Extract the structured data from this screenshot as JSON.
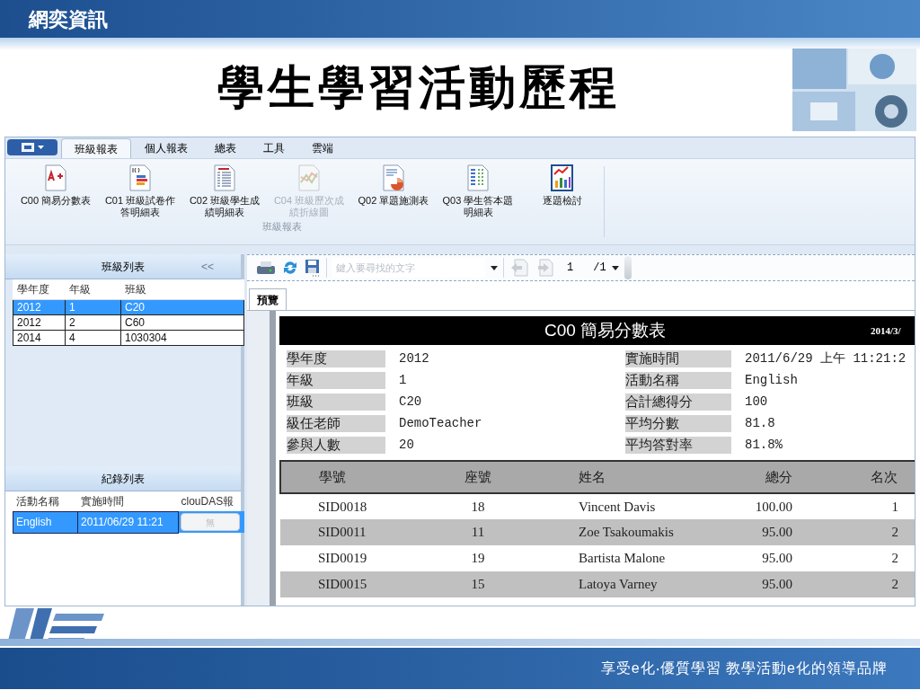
{
  "slide": {
    "brand": "網奕資訊",
    "title": "學生學習活動歷程",
    "slogan": "享受e化‧優質學習 教學活動e化的領導品牌"
  },
  "ribbon_tabs": [
    {
      "label": "班級報表",
      "selected": true
    },
    {
      "label": "個人報表",
      "selected": false
    },
    {
      "label": "總表",
      "selected": false
    },
    {
      "label": "工具",
      "selected": false
    },
    {
      "label": "雲端",
      "selected": false
    }
  ],
  "ribbon_buttons": [
    {
      "kind": "grade",
      "label": "C00 簡易分數表",
      "disabled": false
    },
    {
      "kind": "bars",
      "label": "C01 班級試卷作答明細表",
      "disabled": false
    },
    {
      "kind": "list",
      "label": "C02 班級學生成績明細表",
      "disabled": false
    },
    {
      "kind": "line",
      "label": "C04 班級歷次成績折線圖",
      "disabled": true
    },
    {
      "kind": "pie",
      "label": "Q02 單題施測表",
      "disabled": false
    },
    {
      "kind": "matrix",
      "label": "Q03 學生答本題明細表",
      "disabled": false
    },
    {
      "kind": "chart",
      "label": "逐題檢討",
      "disabled": false
    }
  ],
  "ribbon_group": "班級報表",
  "class_list": {
    "title": "班級列表",
    "collapse": "<<",
    "columns": [
      "學年度",
      "年級",
      "班級"
    ],
    "rows": [
      {
        "cells": [
          "2012",
          "1",
          "C20"
        ],
        "selected": true
      },
      {
        "cells": [
          "2012",
          "2",
          "C60"
        ],
        "selected": false
      },
      {
        "cells": [
          "2014",
          "4",
          "1030304"
        ],
        "selected": false
      }
    ]
  },
  "record_list": {
    "title": "紀錄列表",
    "columns": [
      "活動名稱",
      "實施時間",
      "clouDAS報"
    ],
    "rows": [
      {
        "cells": [
          "English",
          "2011/06/29 11:21"
        ],
        "button": "無",
        "selected": true
      }
    ]
  },
  "toolbar": {
    "search_placeholder": "鍵入要尋找的文字",
    "page": "1",
    "total": "/1"
  },
  "preview_tab": {
    "label": "預覽",
    "selected": true
  },
  "report": {
    "title": "C00 簡易分數表",
    "date": "2014/3/",
    "fields_left": [
      {
        "label": "學年度",
        "value": "2012"
      },
      {
        "label": "年級",
        "value": "1"
      },
      {
        "label": "班級",
        "value": "C20"
      },
      {
        "label": "級任老師",
        "value": "DemoTeacher"
      },
      {
        "label": "參與人數",
        "value": "20"
      }
    ],
    "fields_right": [
      {
        "label": "實施時間",
        "value": "2011/6/29 上午 11:21:2"
      },
      {
        "label": "活動名稱",
        "value": "English"
      },
      {
        "label": "合計總得分",
        "value": "100"
      },
      {
        "label": "平均分數",
        "value": "81.8"
      },
      {
        "label": "平均答對率",
        "value": "81.8%"
      }
    ],
    "columns": [
      "學號",
      "座號",
      "姓名",
      "總分",
      "名次"
    ],
    "rows": [
      [
        "SID0018",
        "18",
        "Vincent Davis",
        "100.00",
        "1"
      ],
      [
        "SID0011",
        "11",
        "Zoe Tsakoumakis",
        "95.00",
        "2"
      ],
      [
        "SID0019",
        "19",
        "Bartista Malone",
        "95.00",
        "2"
      ],
      [
        "SID0015",
        "15",
        "Latoya Varney",
        "95.00",
        "2"
      ]
    ]
  }
}
